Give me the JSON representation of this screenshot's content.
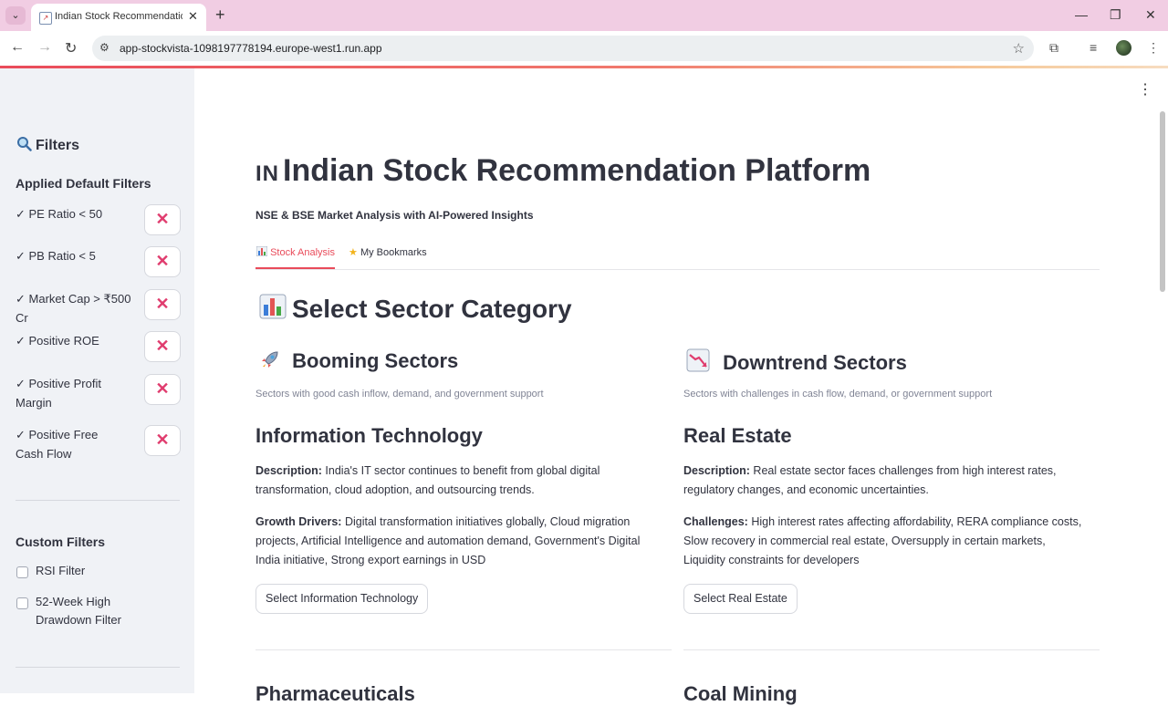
{
  "browser": {
    "tab_title": "Indian Stock Recommendation",
    "url": "app-stockvista-1098197778194.europe-west1.run.app"
  },
  "sidebar": {
    "title": "Filters",
    "applied_heading": "Applied Default Filters",
    "applied_filters": [
      "✓ PE Ratio < 50",
      "✓ PB Ratio < 5",
      "✓ Market Cap > ₹500 Cr",
      "✓ Positive ROE",
      "✓ Positive Profit Margin",
      "✓ Positive Free Cash Flow"
    ],
    "remove_label": "✕",
    "custom_heading": "Custom Filters",
    "custom_filters": [
      "RSI Filter",
      "52-Week High Drawdown Filter"
    ]
  },
  "main": {
    "flag": "IN",
    "title": "Indian Stock Recommendation Platform",
    "subtitle": "NSE & BSE Market Analysis with AI-Powered Insights",
    "tabs": [
      "Stock Analysis",
      "My Bookmarks"
    ],
    "section_title": "Select Sector Category",
    "booming": {
      "heading": "Booming Sectors",
      "caption": "Sectors with good cash inflow, demand, and government support",
      "sector": "Information Technology",
      "desc_label": "Description:",
      "desc": " India's IT sector continues to benefit from global digital transformation, cloud adoption, and outsourcing trends.",
      "drivers_label": "Growth Drivers:",
      "drivers": " Digital transformation initiatives globally, Cloud migration projects, Artificial Intelligence and automation demand, Government's Digital India initiative, Strong export earnings in USD",
      "button": "Select Information Technology",
      "next_sector": "Pharmaceuticals"
    },
    "downtrend": {
      "heading": "Downtrend Sectors",
      "caption": "Sectors with challenges in cash flow, demand, or government support",
      "sector": "Real Estate",
      "desc_label": "Description:",
      "desc": " Real estate sector faces challenges from high interest rates, regulatory changes, and economic uncertainties.",
      "challenges_label": "Challenges:",
      "challenges": " High interest rates affecting affordability, RERA compliance costs, Slow recovery in commercial real estate, Oversupply in certain markets, Liquidity constraints for developers",
      "button": "Select Real Estate",
      "next_sector": "Coal Mining"
    }
  },
  "colors": {
    "accent": "#e94b5a",
    "remove_icon": "#e03c6e",
    "sidebar_bg": "#f0f2f6",
    "tab_bar_bg": "#f1cde3"
  }
}
